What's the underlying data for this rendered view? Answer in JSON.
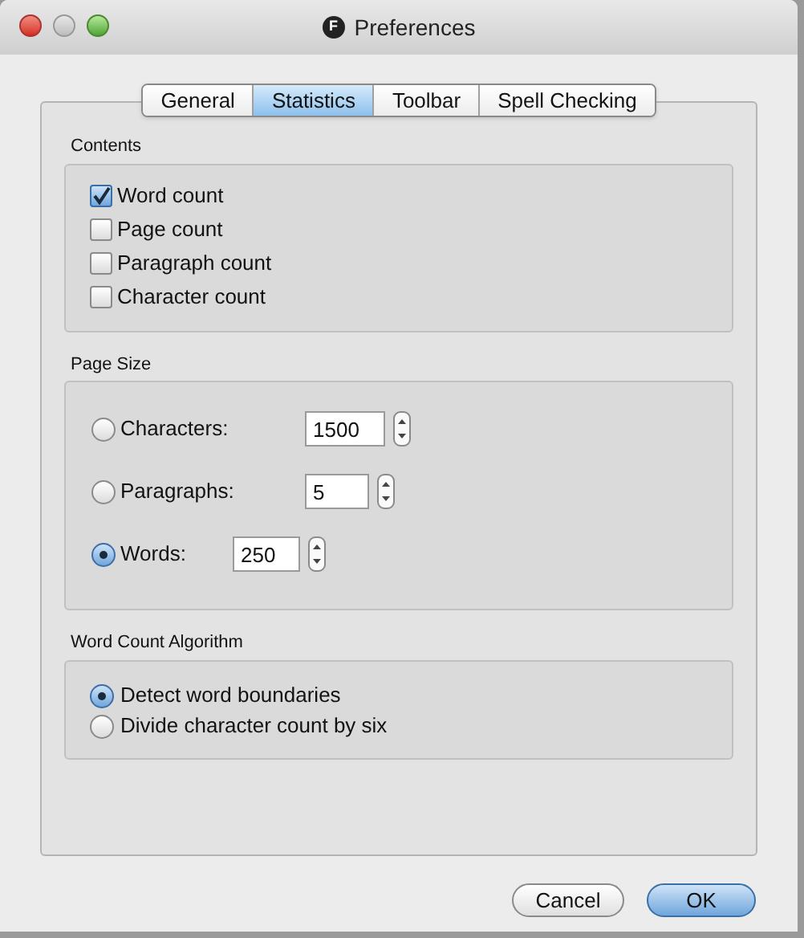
{
  "window": {
    "title": "Preferences",
    "icon_letter": "F"
  },
  "tabs": [
    {
      "label": "General",
      "selected": false
    },
    {
      "label": "Statistics",
      "selected": true
    },
    {
      "label": "Toolbar",
      "selected": false
    },
    {
      "label": "Spell Checking",
      "selected": false
    }
  ],
  "contents": {
    "title": "Contents",
    "items": [
      {
        "label": "Word count",
        "checked": true
      },
      {
        "label": "Page count",
        "checked": false
      },
      {
        "label": "Paragraph count",
        "checked": false
      },
      {
        "label": "Character count",
        "checked": false
      }
    ]
  },
  "page_size": {
    "title": "Page Size",
    "options": [
      {
        "label": "Characters:",
        "value": "1500",
        "selected": false
      },
      {
        "label": "Paragraphs:",
        "value": "5",
        "selected": false
      },
      {
        "label": "Words:",
        "value": "250",
        "selected": true
      }
    ]
  },
  "algorithm": {
    "title": "Word Count Algorithm",
    "options": [
      {
        "label": "Detect word boundaries",
        "selected": true
      },
      {
        "label": "Divide character count by six",
        "selected": false
      }
    ]
  },
  "buttons": [
    {
      "label": "Cancel",
      "default": false
    },
    {
      "label": "OK",
      "default": true
    }
  ]
}
